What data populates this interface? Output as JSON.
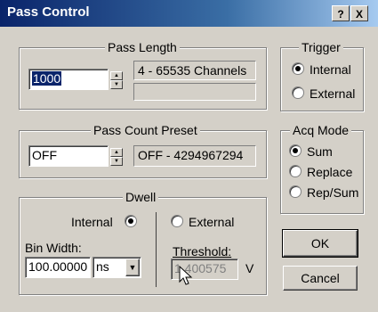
{
  "window": {
    "title": "Pass Control",
    "help_btn": "?",
    "close_btn": "X"
  },
  "pass_length": {
    "legend": "Pass Length",
    "value": "1000",
    "range": "4 - 65535 Channels",
    "extra": ""
  },
  "pass_count": {
    "legend": "Pass Count Preset",
    "value": "OFF",
    "range": "OFF - 4294967294"
  },
  "dwell": {
    "legend": "Dwell",
    "internal_label": "Internal",
    "external_label": "External",
    "selected": "Internal",
    "bin_width_label": "Bin Width:",
    "bin_width_value": "100.00000",
    "unit": "ns",
    "threshold_label": "Threshold:",
    "threshold_value": "1.400575",
    "threshold_unit": "V"
  },
  "trigger": {
    "legend": "Trigger",
    "options": [
      "Internal",
      "External"
    ],
    "selected": "Internal"
  },
  "acq_mode": {
    "legend": "Acq Mode",
    "options": [
      "Sum",
      "Replace",
      "Rep/Sum"
    ],
    "selected": "Sum"
  },
  "buttons": {
    "ok": "OK",
    "cancel": "Cancel"
  }
}
